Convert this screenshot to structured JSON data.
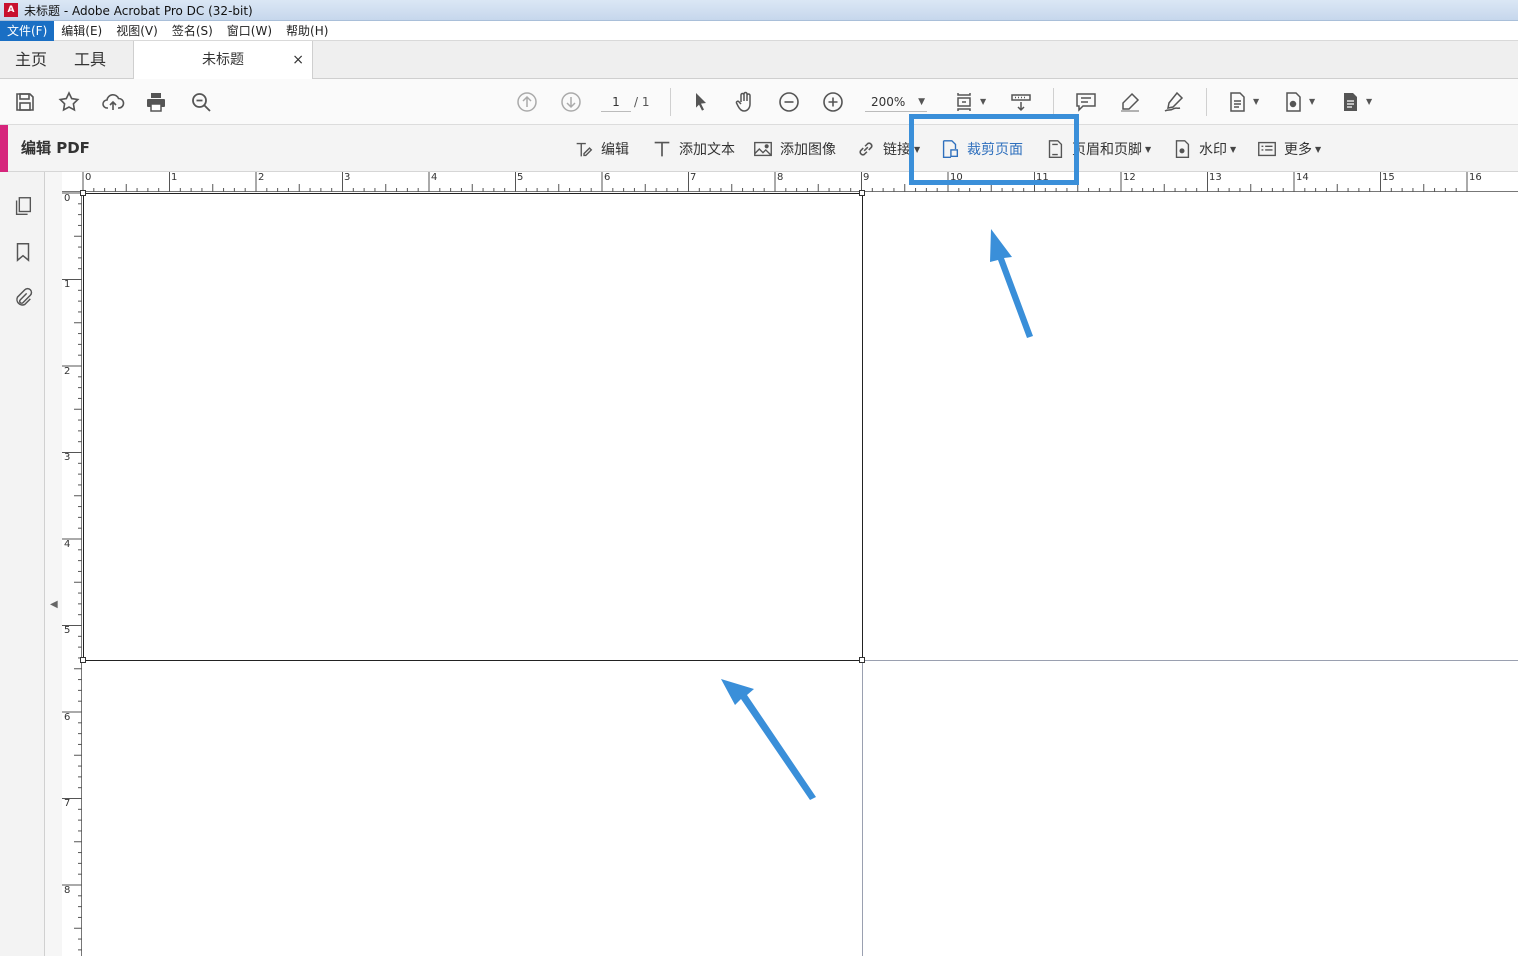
{
  "window": {
    "title": "未标题 - Adobe Acrobat Pro DC (32-bit)",
    "icon_glyph": "A"
  },
  "menu": {
    "items": [
      "文件(F)",
      "编辑(E)",
      "视图(V)",
      "签名(S)",
      "窗口(W)",
      "帮助(H)"
    ],
    "active_index": 0
  },
  "tabs": {
    "home": "主页",
    "tools": "工具",
    "document": "未标题",
    "close_glyph": "×"
  },
  "toolbar": {
    "page_current": "1",
    "page_total": "/ 1",
    "zoom": "200%"
  },
  "edit_bar": {
    "title": "编辑 PDF",
    "tools": {
      "edit": "编辑",
      "add_text": "添加文本",
      "add_image": "添加图像",
      "link": "链接",
      "crop_pages": "裁剪页面",
      "header_footer": "页眉和页脚",
      "watermark": "水印",
      "more": "更多"
    }
  },
  "rulers": {
    "top": [
      "0",
      "1",
      "2",
      "3",
      "4",
      "5",
      "6",
      "7",
      "8",
      "9",
      "10",
      "11",
      "12",
      "13",
      "14",
      "15",
      "16"
    ],
    "left": [
      "0",
      "1",
      "2",
      "3",
      "4",
      "5",
      "6",
      "7",
      "8"
    ]
  },
  "colors": {
    "accent_pink": "#d6257c",
    "annotation_blue": "#3a8fd9",
    "menu_active": "#1a6fc4",
    "highlight_text": "#2e6fbd"
  }
}
